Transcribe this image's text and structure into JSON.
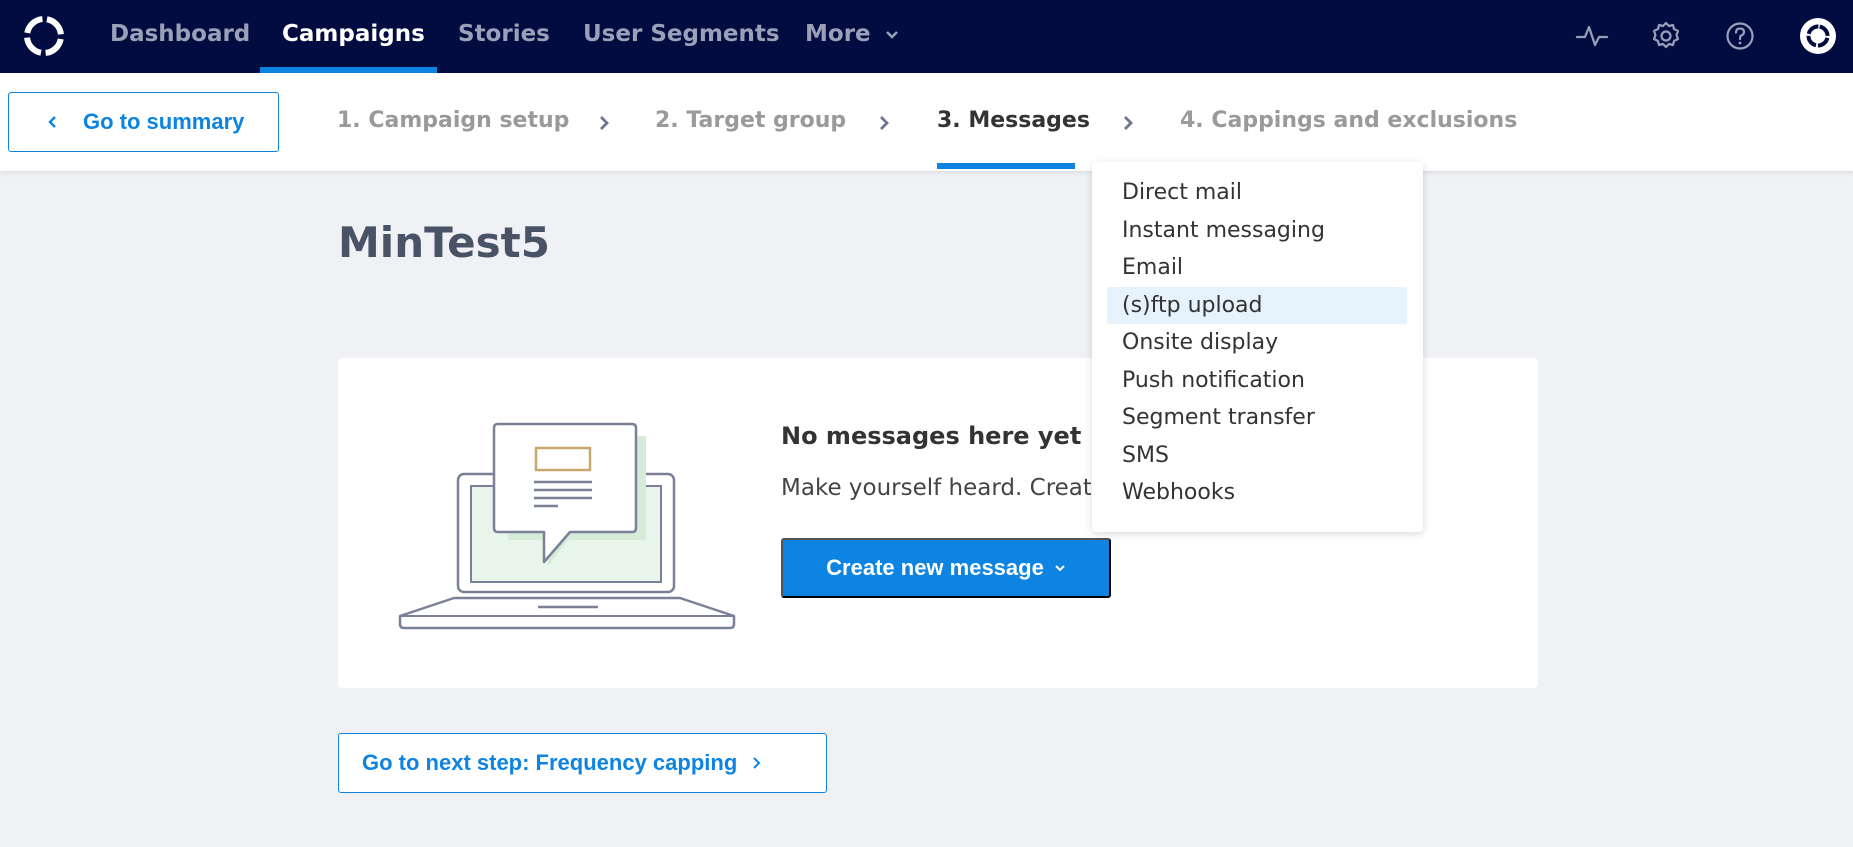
{
  "topnav": {
    "items": [
      {
        "label": "Dashboard"
      },
      {
        "label": "Campaigns"
      },
      {
        "label": "Stories"
      },
      {
        "label": "User Segments"
      },
      {
        "label": "More"
      }
    ],
    "active_index": 1,
    "icons": [
      "activity-icon",
      "gear-icon",
      "help-icon",
      "profile-icon"
    ]
  },
  "stepbar": {
    "summary_label": "Go to summary",
    "steps": [
      {
        "label": "1. Campaign setup"
      },
      {
        "label": "2. Target group"
      },
      {
        "label": "3. Messages"
      },
      {
        "label": "4. Cappings and exclusions"
      }
    ],
    "active_index": 2
  },
  "main": {
    "title": "MinTest5",
    "empty_heading": "No messages here yet",
    "empty_text": "Make yourself heard. Create a",
    "create_label": "Create new message",
    "next_label": "Go to next step: Frequency capping"
  },
  "dropdown": {
    "items": [
      {
        "label": "Direct mail"
      },
      {
        "label": "Instant messaging"
      },
      {
        "label": "Email"
      },
      {
        "label": "(s)ftp upload"
      },
      {
        "label": "Onsite display"
      },
      {
        "label": "Push notification"
      },
      {
        "label": "Segment transfer"
      },
      {
        "label": "SMS"
      },
      {
        "label": "Webhooks"
      }
    ],
    "highlighted_index": 3
  },
  "colors": {
    "nav_bg": "#030c40",
    "accent": "#0e84e2",
    "page_bg": "#eff1f5",
    "highlight": "#e6f2fc"
  }
}
